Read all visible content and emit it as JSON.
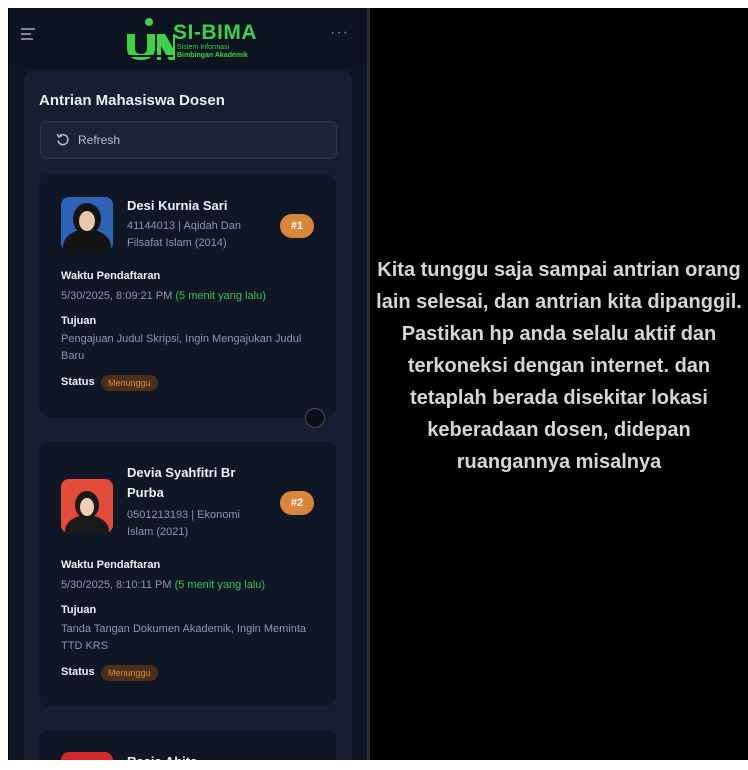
{
  "header": {
    "logo_title": "SI-BIMA",
    "logo_sub_line1": "Sistem Informasi",
    "logo_sub_line2": "Bimbingan Akademik",
    "more": "···"
  },
  "panel": {
    "title": "Antrian Mahasiswa Dosen",
    "refresh_label": "Refresh"
  },
  "queue": [
    {
      "name": "Desi Kurnia Sari",
      "meta": "41144013 | Aqidah Dan Filsafat Islam (2014)",
      "rank": "#1",
      "waktu_label": "Waktu Pendaftaran",
      "waktu_value": "5/30/2025, 8:09:21 PM",
      "ago": "(5 menit yang lalu)",
      "tujuan_label": "Tujuan",
      "tujuan_value": "Pengajuan Judul Skripsi, Ingin Mengajukan Judul Baru",
      "status_label": "Status",
      "status_value": "Menunggu"
    },
    {
      "name": "Devia Syahfitri Br Purba",
      "meta": "0501213193 | Ekonomi Islam (2021)",
      "rank": "#2",
      "waktu_label": "Waktu Pendaftaran",
      "waktu_value": "5/30/2025, 8:10:11 PM",
      "ago": "(5 menit yang lalu)",
      "tujuan_label": "Tujuan",
      "tujuan_value": "Tanda Tangan Dokumen Akademik, Ingin Meminta TTD KRS",
      "status_label": "Status",
      "status_value": "Menunggu"
    },
    {
      "name": "Rasis Ahita"
    }
  ],
  "caption": "Kita tunggu saja sampai antrian orang lain selesai, dan antrian kita dipanggil. Pastikan hp anda selalu aktif dan terkoneksi dengan internet. dan tetaplah berada disekitar lokasi keberadaan dosen, didepan ruangannya misalnya",
  "colors": {
    "accent_green": "#3fd04a",
    "badge_orange": "#d9863a",
    "bg_dark": "#0f1623"
  }
}
